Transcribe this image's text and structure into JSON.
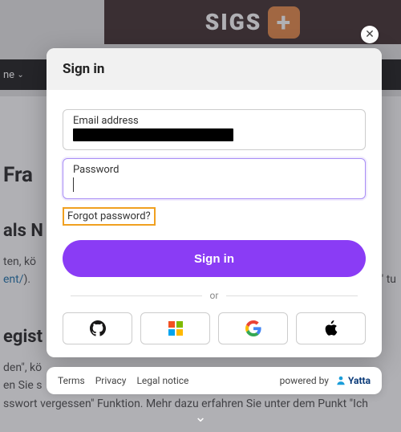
{
  "background": {
    "banner_text": "SIGS",
    "nav_item": "ne",
    "h1": "Fra",
    "h2a": "als N",
    "p1_a": "ten, kö",
    "p1_link": "ent/",
    "p1_b": ").",
    "h2b": "egist",
    "p2_a": "den\", kö",
    "p2_b": "en Sie s",
    "p2_c": "sswort vergessen\" Funktion. Mehr dazu erfahren Sie unter dem Punkt \"Ich",
    "tu": "\" tu"
  },
  "modal": {
    "title": "Sign in",
    "email_label": "Email address",
    "password_label": "Password",
    "forgot": "Forgot password?",
    "signin": "Sign in",
    "or": "or"
  },
  "footer": {
    "terms": "Terms",
    "privacy": "Privacy",
    "legal": "Legal notice",
    "powered": "powered by",
    "brand": "Yatta"
  }
}
